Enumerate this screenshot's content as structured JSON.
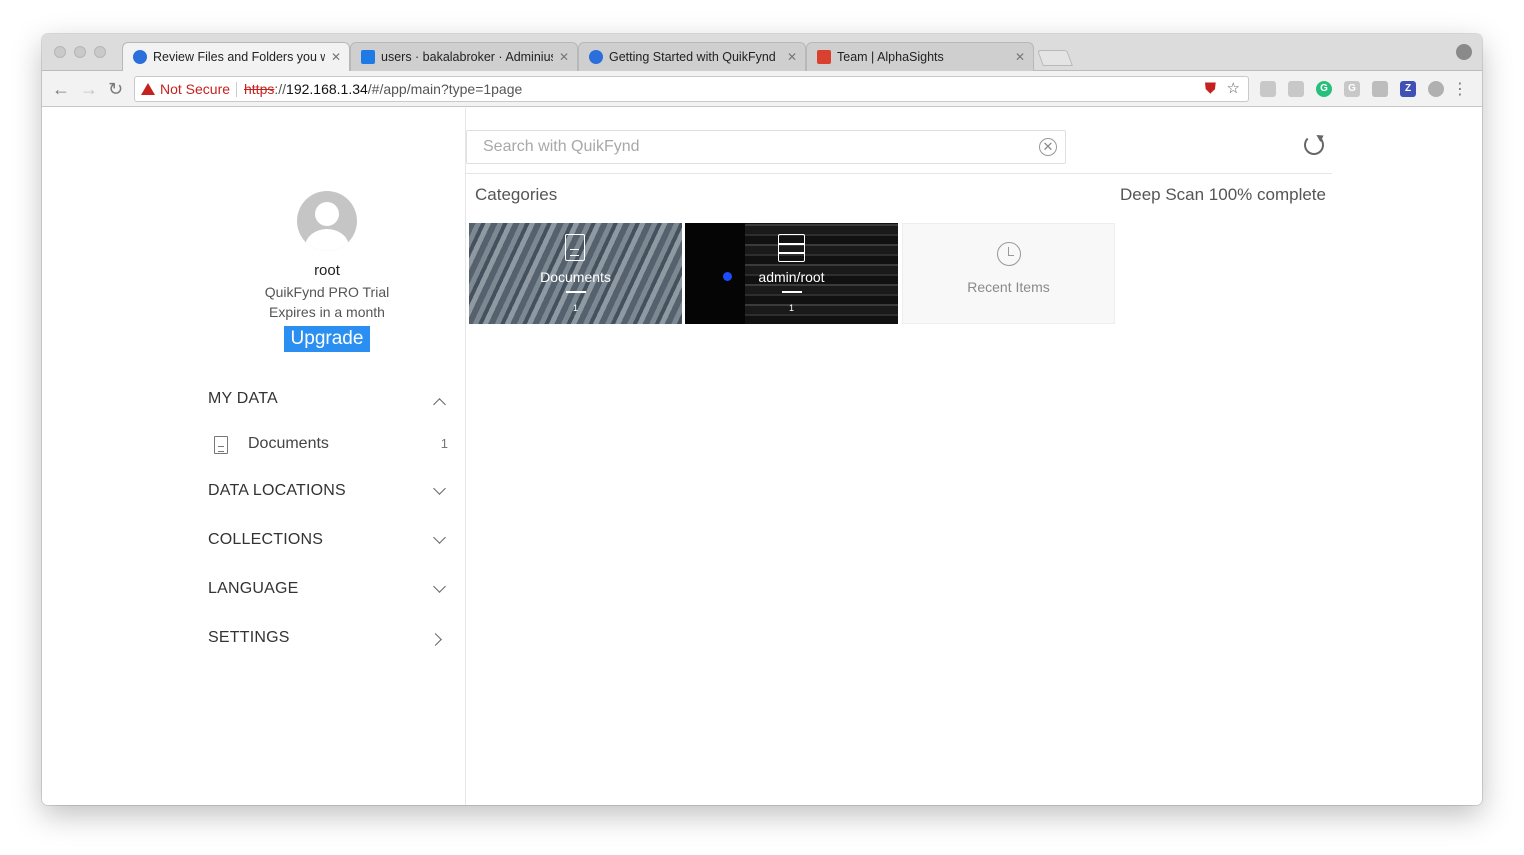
{
  "browser": {
    "tabs": [
      {
        "label": "Review Files and Folders you w",
        "favicon_color": "#2a6fdb"
      },
      {
        "label": "users · bakalabroker · Adminius",
        "favicon_color": "#1e7be6"
      },
      {
        "label": "Getting Started with QuikFynd",
        "favicon_color": "#2a6fdb"
      },
      {
        "label": "Team | AlphaSights",
        "favicon_color": "#d9412e"
      }
    ],
    "security_label": "Not Secure",
    "url_scheme": "https",
    "url_host": "192.168.1.34",
    "url_path": "/#/app/main?type=1page"
  },
  "user": {
    "name": "root",
    "plan": "QuikFynd PRO Trial",
    "expires": "Expires in a month",
    "upgrade_label": "Upgrade"
  },
  "sidebar": {
    "my_data": "MY DATA",
    "documents_label": "Documents",
    "documents_count": "1",
    "data_locations": "DATA LOCATIONS",
    "collections": "COLLECTIONS",
    "language": "LANGUAGE",
    "settings": "SETTINGS"
  },
  "search": {
    "placeholder": "Search with QuikFynd",
    "value": ""
  },
  "main": {
    "categories_title": "Categories",
    "scan_status": "Deep Scan 100% complete",
    "tiles": [
      {
        "label": "Documents",
        "count": "1"
      },
      {
        "label": "admin/root",
        "count": "1"
      },
      {
        "label": "Recent Items",
        "count": ""
      }
    ]
  },
  "colors": {
    "accent": "#2a8ff0",
    "warning": "#c5221f"
  }
}
